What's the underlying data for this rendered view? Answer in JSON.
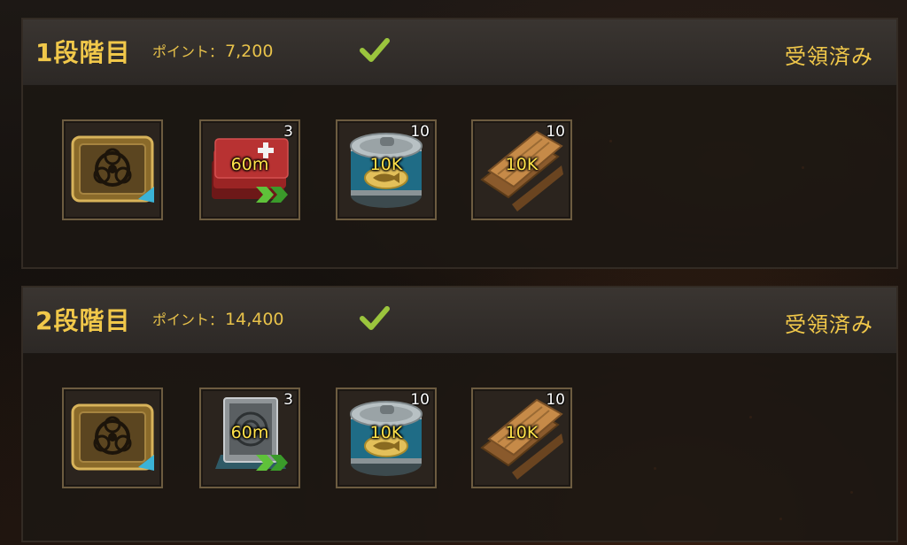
{
  "tiers": [
    {
      "title": "1段階目",
      "points_label": "ポイント：",
      "points_value": "7,200",
      "status": "受領済み",
      "items": [
        {
          "icon": "biohazard-crate-icon",
          "qty": "",
          "amount": ""
        },
        {
          "icon": "red-medkit-speedup-icon",
          "qty": "3",
          "amount": "60m"
        },
        {
          "icon": "canned-food-icon",
          "qty": "10",
          "amount": "10K"
        },
        {
          "icon": "wood-planks-icon",
          "qty": "10",
          "amount": "10K"
        }
      ]
    },
    {
      "title": "2段階目",
      "points_label": "ポイント：",
      "points_value": "14,400",
      "status": "受領済み",
      "items": [
        {
          "icon": "biohazard-crate-icon",
          "qty": "",
          "amount": ""
        },
        {
          "icon": "radar-speedup-icon",
          "qty": "3",
          "amount": "60m"
        },
        {
          "icon": "canned-food-icon",
          "qty": "10",
          "amount": "10K"
        },
        {
          "icon": "wood-planks-icon",
          "qty": "10",
          "amount": "10K"
        }
      ]
    }
  ],
  "colors": {
    "accent_gold": "#f1c84a",
    "check_green": "#9bc53d",
    "amount_yellow": "#ffe24a"
  }
}
